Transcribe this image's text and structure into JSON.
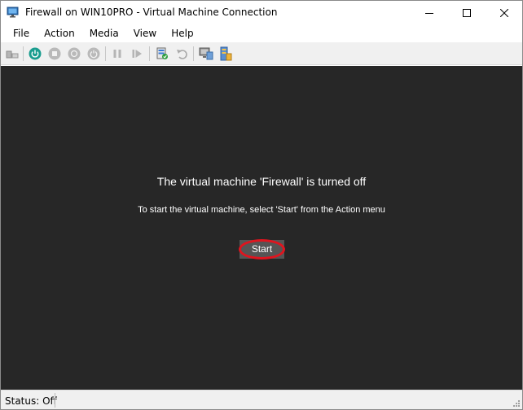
{
  "window": {
    "title": "Firewall on WIN10PRO - Virtual Machine Connection"
  },
  "menu": {
    "items": [
      "File",
      "Action",
      "Media",
      "View",
      "Help"
    ]
  },
  "toolbar": {
    "buttons": [
      {
        "icon": "ctrl-alt-del-icon"
      },
      {
        "icon": "power-start-icon",
        "color": "#1a9d8f"
      },
      {
        "icon": "turn-off-icon"
      },
      {
        "icon": "shutdown-icon"
      },
      {
        "icon": "save-state-icon"
      },
      {
        "icon": "pause-icon"
      },
      {
        "icon": "resume-icon"
      },
      {
        "icon": "checkpoint-icon"
      },
      {
        "icon": "revert-icon"
      },
      {
        "icon": "enhanced-session-icon"
      },
      {
        "icon": "share-icon"
      }
    ]
  },
  "console": {
    "message": "The virtual machine 'Firewall' is turned off",
    "hint": "To start the virtual machine, select 'Start' from the Action menu",
    "start_label": "Start",
    "highlight_color": "#e0141e"
  },
  "status": {
    "text": "Status: Off"
  }
}
